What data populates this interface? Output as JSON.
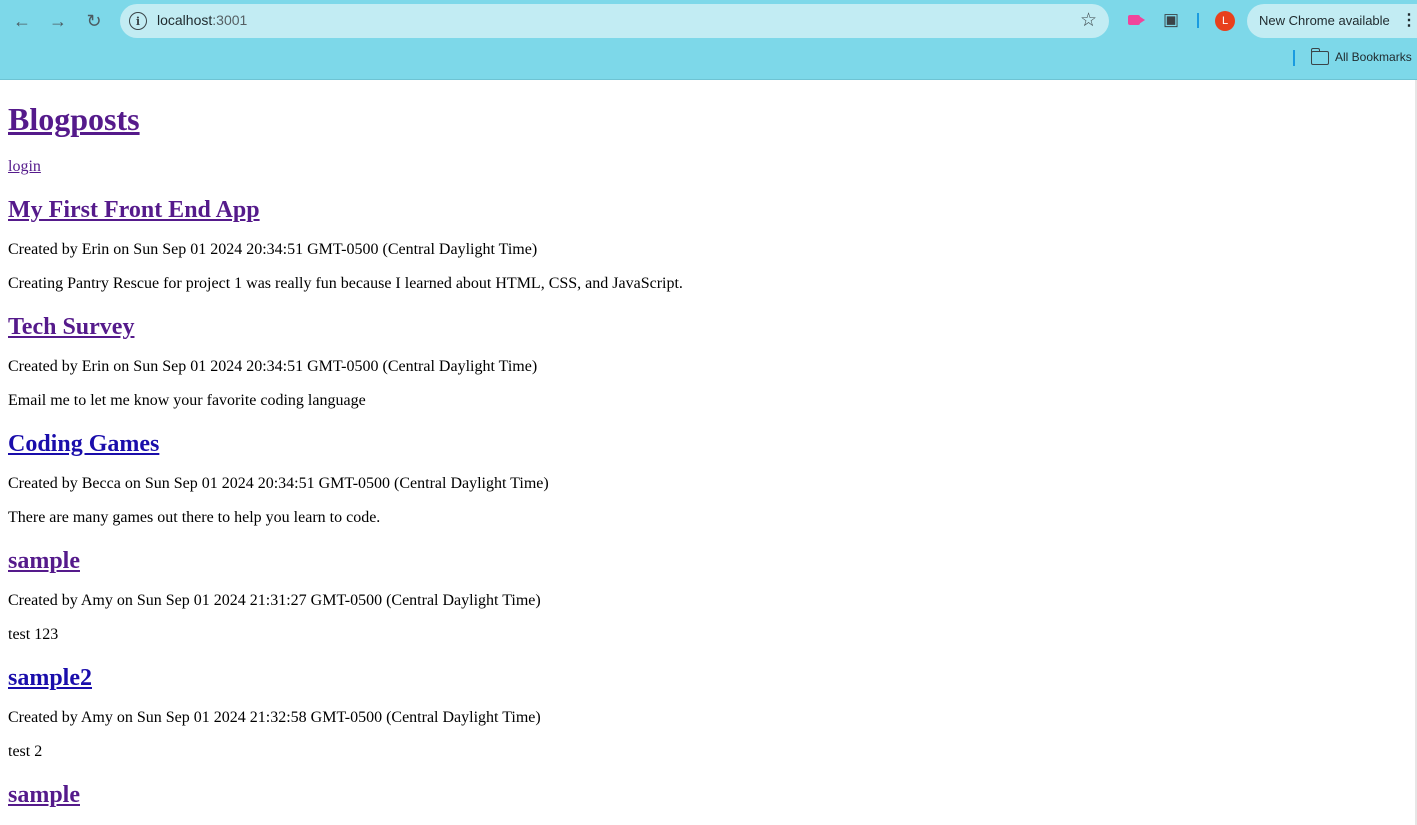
{
  "browser": {
    "url_host": "localhost",
    "url_port": ":3001",
    "update_label": "New Chrome available",
    "avatar_initial": "L",
    "bookmarks_label": "All Bookmarks"
  },
  "page": {
    "title": "Blogposts",
    "login_label": "login",
    "posts": [
      {
        "title": "My First Front End App",
        "meta": "Created by Erin on Sun Sep 01 2024 20:34:51 GMT-0500 (Central Daylight Time)",
        "body": "Creating Pantry Rescue for project 1 was really fun because I learned about HTML, CSS, and JavaScript."
      },
      {
        "title": "Tech Survey",
        "meta": "Created by Erin on Sun Sep 01 2024 20:34:51 GMT-0500 (Central Daylight Time)",
        "body": "Email me to let me know your favorite coding language"
      },
      {
        "title": "Coding Games",
        "meta": "Created by Becca on Sun Sep 01 2024 20:34:51 GMT-0500 (Central Daylight Time)",
        "body": "There are many games out there to help you learn to code."
      },
      {
        "title": "sample",
        "meta": "Created by Amy on Sun Sep 01 2024 21:31:27 GMT-0500 (Central Daylight Time)",
        "body": "test 123"
      },
      {
        "title": "sample2",
        "meta": "Created by Amy on Sun Sep 01 2024 21:32:58 GMT-0500 (Central Daylight Time)",
        "body": "test 2"
      },
      {
        "title": "sample",
        "meta": "",
        "body": ""
      }
    ]
  }
}
